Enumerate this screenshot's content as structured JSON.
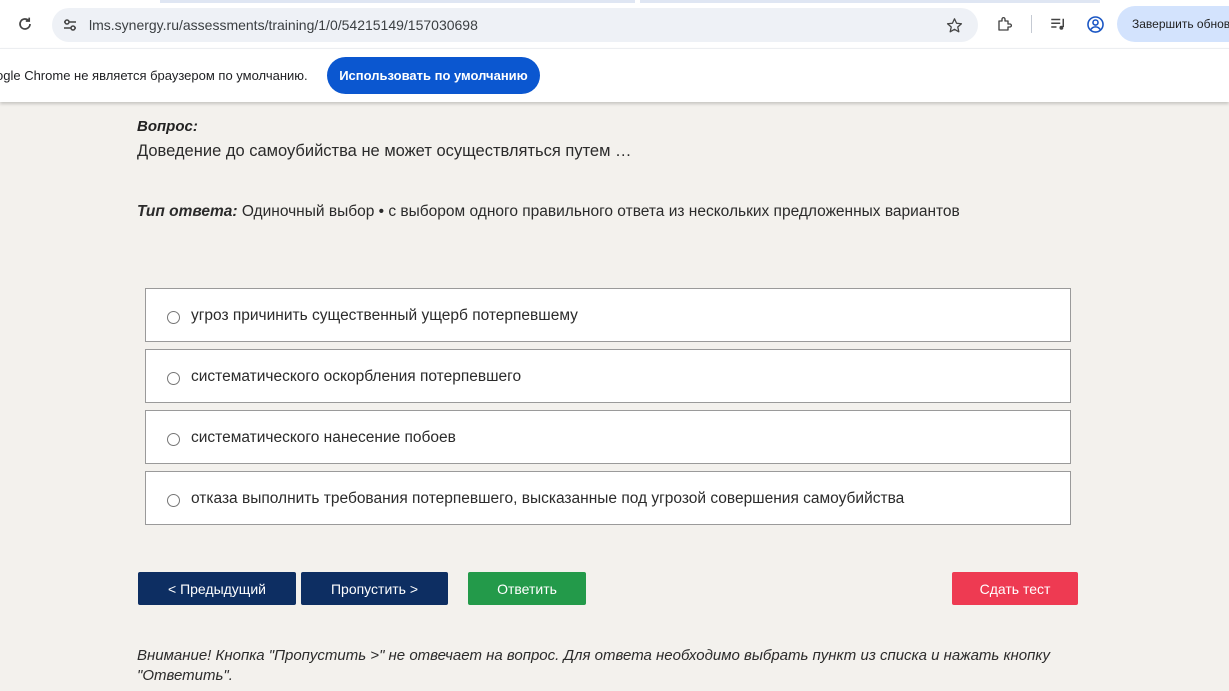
{
  "browser": {
    "url": "lms.synergy.ru/assessments/training/1/0/54215149/157030698",
    "update_button_label": "Завершить обнов",
    "infobar_text": "ogle Chrome не является браузером по умолчанию.",
    "default_button_label": "Использовать по умолчанию",
    "icons": {
      "reload": "reload-icon",
      "site_info": "site-settings-icon",
      "bookmark": "star-icon",
      "extensions": "puzzle-icon",
      "media": "media-queue-icon",
      "profile": "profile-icon"
    }
  },
  "question": {
    "label": "Вопрос:",
    "text": "Доведение до самоубийства не может осуществляться путем …",
    "answer_type_label": "Тип ответа:",
    "answer_type_value": " Одиночный выбор • с выбором одного правильного ответа из нескольких предложенных вариантов"
  },
  "options": [
    "угроз причинить существенный ущерб потерпевшему",
    "систематического оскорбления потерпевшего",
    "систематического нанесение побоев",
    "отказа выполнить требования потерпевшего, высказанные под угрозой совершения самоубийства"
  ],
  "buttons": {
    "prev": "< Предыдущий",
    "skip": "Пропустить >",
    "answer": "Ответить",
    "finish": "Сдать тест"
  },
  "note": "Внимание! Кнопка \"Пропустить >\" не отвечает на вопрос. Для ответа необходимо выбрать пункт из списка и нажать кнопку \"Ответить\".",
  "colors": {
    "page_background": "#f3f1ed",
    "navy": "#0d2e62",
    "green": "#239a4a",
    "red": "#ee3a52",
    "chrome_blue": "#0b57d0"
  }
}
